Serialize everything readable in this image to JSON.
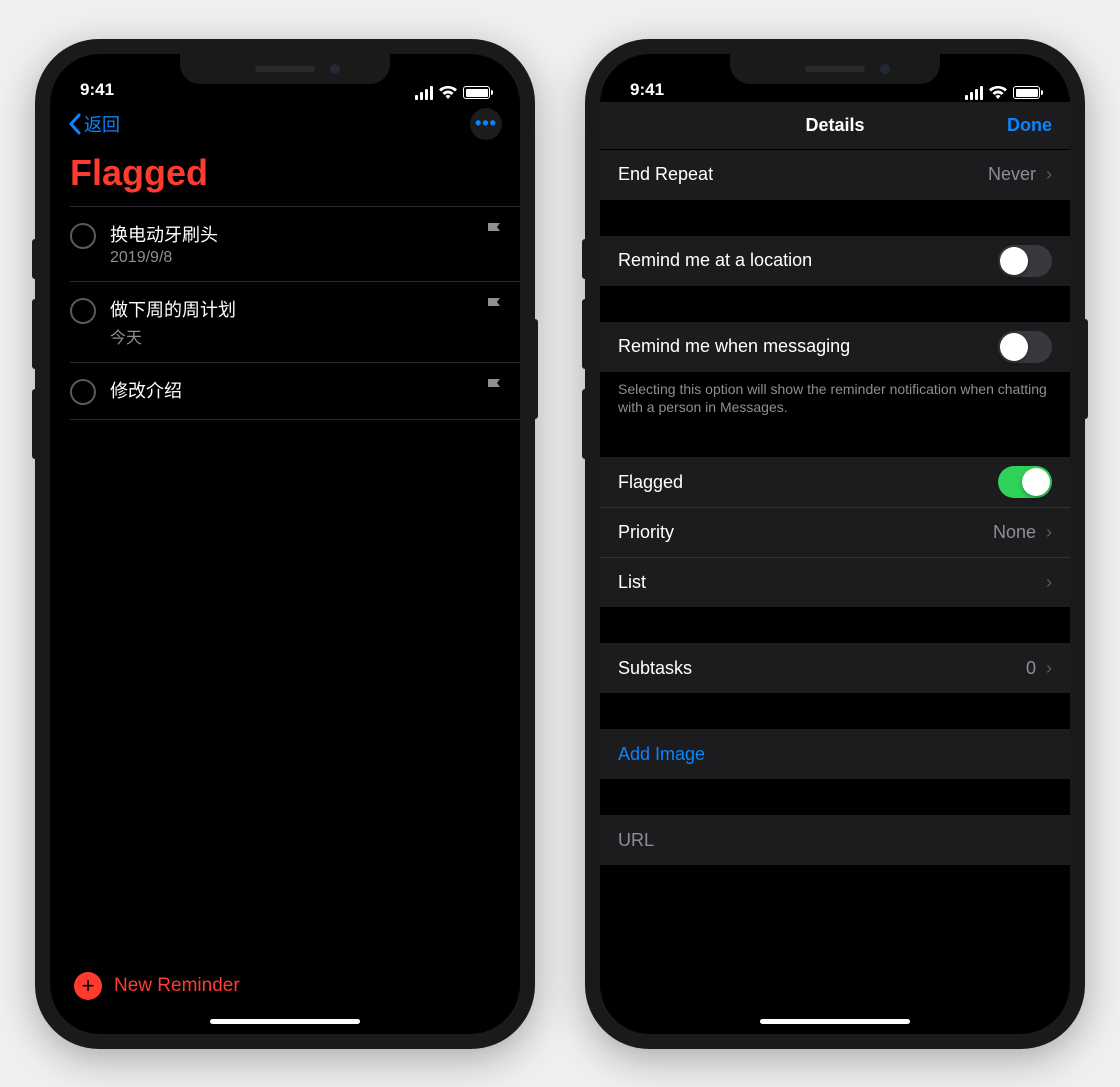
{
  "status": {
    "time": "9:41"
  },
  "phone1": {
    "back_label": "返回",
    "title": "Flagged",
    "items": [
      {
        "title": "换电动牙刷头",
        "sub": "2019/9/8"
      },
      {
        "title": "做下周的周计划",
        "sub": "今天"
      },
      {
        "title": "修改介绍",
        "sub": ""
      }
    ],
    "new_reminder": "New Reminder"
  },
  "phone2": {
    "nav_title": "Details",
    "done": "Done",
    "end_repeat": {
      "label": "End Repeat",
      "value": "Never"
    },
    "location": {
      "label": "Remind me at a location",
      "on": false
    },
    "messaging": {
      "label": "Remind me when messaging",
      "on": false
    },
    "messaging_footer": "Selecting this option will show the reminder notification when chatting with a person in Messages.",
    "flagged": {
      "label": "Flagged",
      "on": true
    },
    "priority": {
      "label": "Priority",
      "value": "None"
    },
    "list": {
      "label": "List"
    },
    "subtasks": {
      "label": "Subtasks",
      "value": "0"
    },
    "add_image": "Add Image",
    "url_placeholder": "URL"
  }
}
